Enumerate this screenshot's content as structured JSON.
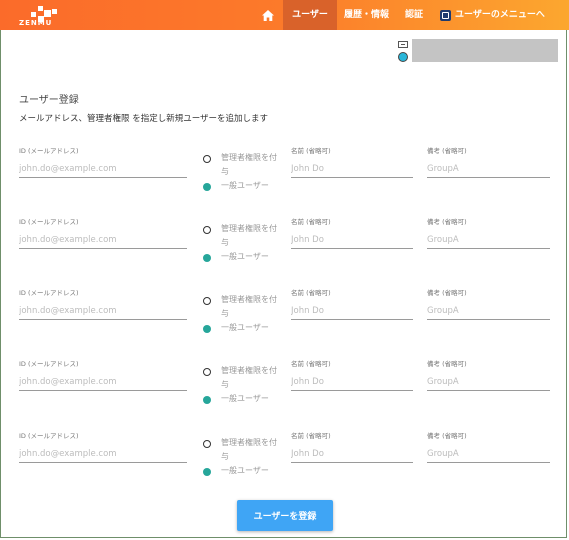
{
  "header": {
    "logo_text": "ZENMU",
    "nav": {
      "users": "ユーザー",
      "history": "履歴・情報",
      "auth": "認証",
      "user_menu": "ユーザーのメニューへ"
    }
  },
  "main": {
    "title": "ユーザー登録",
    "subtitle": "メールアドレス、管理者権限 を指定し新規ユーザーを追加します"
  },
  "form": {
    "rows": [
      {
        "id_label": "ID (メールアドレス)",
        "id_placeholder": "john.do@example.com",
        "admin_label": "管理者権限を付与",
        "admin_selected": false,
        "general_label": "一般ユーザー",
        "general_selected": true,
        "name_label": "名前 (省略可)",
        "name_placeholder": "John Do",
        "note_label": "備考 (省略可)",
        "note_placeholder": "GroupA"
      },
      {
        "id_label": "ID (メールアドレス)",
        "id_placeholder": "john.do@example.com",
        "admin_label": "管理者権限を付与",
        "admin_selected": false,
        "general_label": "一般ユーザー",
        "general_selected": true,
        "name_label": "名前 (省略可)",
        "name_placeholder": "John Do",
        "note_label": "備考 (省略可)",
        "note_placeholder": "GroupA"
      },
      {
        "id_label": "ID (メールアドレス)",
        "id_placeholder": "john.do@example.com",
        "admin_label": "管理者権限を付与",
        "admin_selected": false,
        "general_label": "一般ユーザー",
        "general_selected": true,
        "name_label": "名前 (省略可)",
        "name_placeholder": "John Do",
        "note_label": "備考 (省略可)",
        "note_placeholder": "GroupA"
      },
      {
        "id_label": "ID (メールアドレス)",
        "id_placeholder": "john.do@example.com",
        "admin_label": "管理者権限を付与",
        "admin_selected": false,
        "general_label": "一般ユーザー",
        "general_selected": true,
        "name_label": "名前 (省略可)",
        "name_placeholder": "John Do",
        "note_label": "備考 (省略可)",
        "note_placeholder": "GroupA"
      },
      {
        "id_label": "ID (メールアドレス)",
        "id_placeholder": "john.do@example.com",
        "admin_label": "管理者権限を付与",
        "admin_selected": false,
        "general_label": "一般ユーザー",
        "general_selected": true,
        "name_label": "名前 (省略可)",
        "name_placeholder": "John Do",
        "note_label": "備考 (省略可)",
        "note_placeholder": "GroupA"
      }
    ],
    "submit_label": "ユーザーを登録"
  },
  "colors": {
    "header_start": "#fb6b2a",
    "header_end": "#fca72f",
    "active_tab": "#d9622a",
    "radio_selected": "#26a69a",
    "submit_button": "#3fa5f5"
  },
  "icons": {
    "home": "home-icon",
    "user_menu": "user-menu-icon"
  }
}
